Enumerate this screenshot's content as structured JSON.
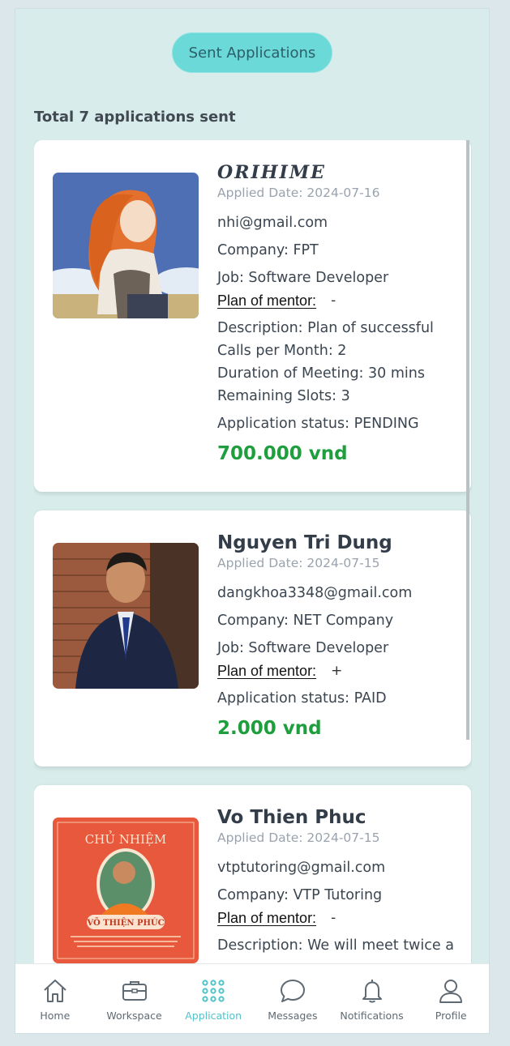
{
  "header": {
    "tab_label": "Sent Applications"
  },
  "summary": {
    "total_text": "Total 7 applications sent"
  },
  "applications": [
    {
      "name": "ORIHIME",
      "applied_date": "Applied Date: 2024-07-16",
      "email": "nhi@gmail.com",
      "company": "Company: FPT",
      "job": "Job: Software Developer",
      "plan_label": "Plan of mentor:",
      "plan_toggle": "-",
      "description": "Description: Plan of successful",
      "calls": "Calls per Month: 2",
      "duration": "Duration of Meeting: 30 mins",
      "slots": "Remaining Slots: 3",
      "status": "Application status: PENDING",
      "price": "700.000 vnd"
    },
    {
      "name": "Nguyen Tri Dung",
      "applied_date": "Applied Date: 2024-07-15",
      "email": "dangkhoa3348@gmail.com",
      "company": "Company: NET Company",
      "job": "Job: Software Developer",
      "plan_label": "Plan of mentor:",
      "plan_toggle": "+",
      "status": "Application status: PAID",
      "price": "2.000 vnd"
    },
    {
      "name": "Vo Thien Phuc",
      "applied_date": "Applied Date: 2024-07-15",
      "email": "vtptutoring@gmail.com",
      "company": "Company: VTP Tutoring",
      "plan_label": "Plan of mentor:",
      "plan_toggle": "-",
      "description": "Description: We will meet twice a",
      "poster_title": "CHỦ NHIỆM",
      "poster_name": "VÕ THIỆN PHÚC"
    }
  ],
  "nav": [
    {
      "label": "Home",
      "icon": "home-icon"
    },
    {
      "label": "Workspace",
      "icon": "briefcase-icon"
    },
    {
      "label": "Application",
      "icon": "grid-dots-icon",
      "active": true
    },
    {
      "label": "Messages",
      "icon": "chat-bubble-icon"
    },
    {
      "label": "Notifications",
      "icon": "bell-icon"
    },
    {
      "label": "Profile",
      "icon": "user-icon"
    }
  ],
  "colors": {
    "accent": "#6ad9d7",
    "price": "#1f9e3e",
    "active_nav": "#4fc3c8",
    "background": "#d8eceb"
  }
}
